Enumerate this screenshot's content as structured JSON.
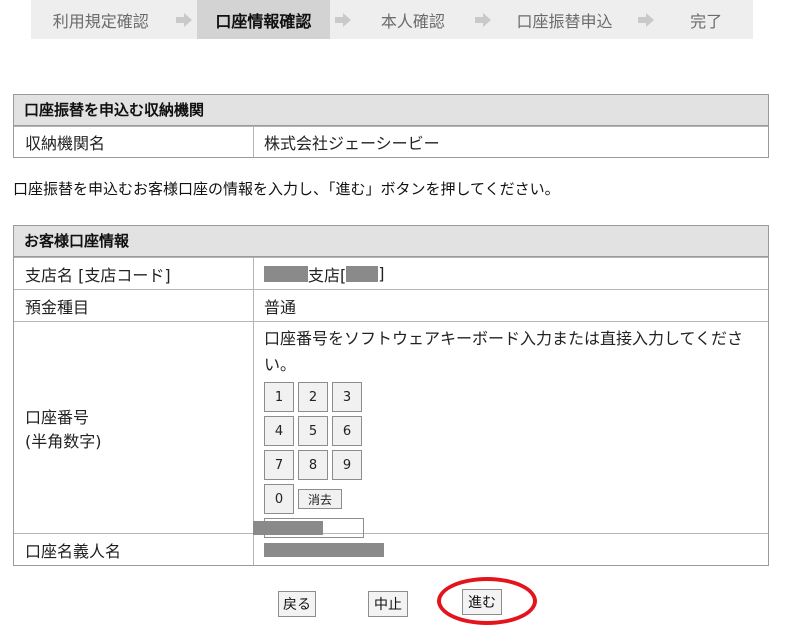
{
  "steps": [
    {
      "label": "利用規定確認",
      "active": false
    },
    {
      "label": "口座情報確認",
      "active": true
    },
    {
      "label": "本人確認",
      "active": false
    },
    {
      "label": "口座振替申込",
      "active": false
    },
    {
      "label": "完了",
      "active": false
    }
  ],
  "institution": {
    "title": "口座振替を申込む収納機関",
    "name_label": "収納機関名",
    "name_value": "株式会社ジェーシービー"
  },
  "instruction": "口座振替を申込むお客様口座の情報を入力し、「進む」ボタンを押してください。",
  "account": {
    "title": "お客様口座情報",
    "branch_label": "支店名 [支店コード]",
    "branch_value_suffix": "支店[",
    "branch_value_close": "]",
    "deposit_label": "預金種目",
    "deposit_value": "普通",
    "number_label_1": "口座番号",
    "number_label_2": "(半角数字)",
    "number_hint": "口座番号をソフトウェアキーボード入力または直接入力してください。",
    "keypad": [
      [
        "1",
        "2",
        "3"
      ],
      [
        "4",
        "5",
        "6"
      ],
      [
        "7",
        "8",
        "9"
      ]
    ],
    "key_zero": "0",
    "key_clear": "消去",
    "holder_label": "口座名義人名"
  },
  "buttons": {
    "back": "戻る",
    "cancel": "中止",
    "next": "進む"
  },
  "colors": {
    "highlight_circle": "#e3141c",
    "header_bg": "#e2e2e2",
    "active_step_bg": "#d3d3d3"
  }
}
